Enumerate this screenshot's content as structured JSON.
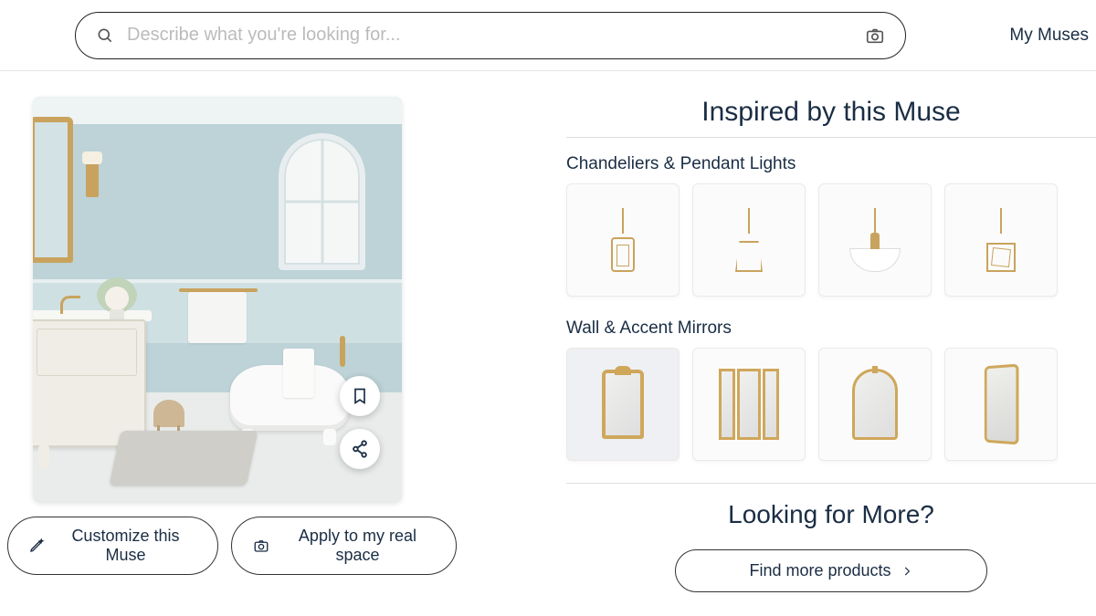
{
  "header": {
    "search_placeholder": "Describe what you're looking for...",
    "nav_my_muses": "My Muses"
  },
  "muse": {
    "customize_label": "Customize this Muse",
    "apply_label": "Apply to my real space"
  },
  "inspired": {
    "title": "Inspired by this Muse",
    "categories": [
      {
        "title": "Chandeliers & Pendant Lights"
      },
      {
        "title": "Wall & Accent Mirrors"
      }
    ],
    "looking_title": "Looking for More?",
    "find_more_label": "Find more products"
  }
}
